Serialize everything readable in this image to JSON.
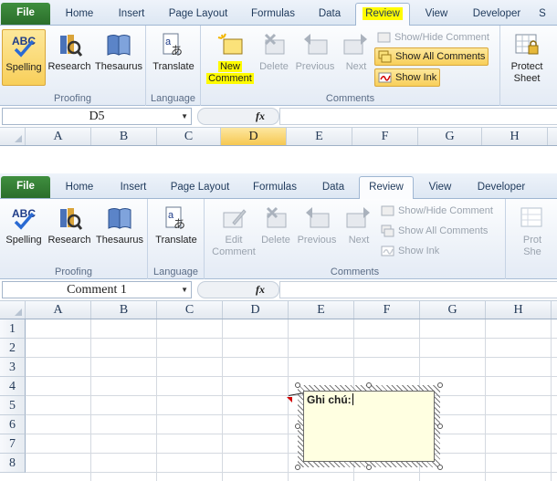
{
  "top": {
    "tabs": [
      "File",
      "Home",
      "Insert",
      "Page Layout",
      "Formulas",
      "Data",
      "Review",
      "View",
      "Developer",
      "S"
    ],
    "active_tab": "Review",
    "proofing": {
      "spelling": "Spelling",
      "research": "Research",
      "thesaurus": "Thesaurus",
      "label": "Proofing"
    },
    "language": {
      "translate": "Translate",
      "label": "Language"
    },
    "comments": {
      "new_comment_line1": "New",
      "new_comment_line2": "Comment",
      "delete": "Delete",
      "previous": "Previous",
      "next": "Next",
      "show_hide": "Show/Hide Comment",
      "show_all": "Show All Comments",
      "show_ink": "Show Ink",
      "label": "Comments"
    },
    "protect": {
      "line1": "Protect",
      "line2": "Sheet"
    },
    "name_box": "D5",
    "fx": "fx",
    "columns": [
      "A",
      "B",
      "C",
      "D",
      "E",
      "F",
      "G",
      "H"
    ],
    "selected_column": "D"
  },
  "bottom": {
    "tabs": [
      "File",
      "Home",
      "Insert",
      "Page Layout",
      "Formulas",
      "Data",
      "Review",
      "View",
      "Developer"
    ],
    "active_tab": "Review",
    "proofing": {
      "spelling": "Spelling",
      "research": "Research",
      "thesaurus": "Thesaurus",
      "label": "Proofing"
    },
    "language": {
      "translate": "Translate",
      "label": "Language"
    },
    "comments": {
      "edit_comment_line1": "Edit",
      "edit_comment_line2": "Comment",
      "delete": "Delete",
      "previous": "Previous",
      "next": "Next",
      "show_hide": "Show/Hide Comment",
      "show_all": "Show All Comments",
      "show_ink": "Show Ink",
      "label": "Comments"
    },
    "protect": {
      "line1": "Prot",
      "line2": "She"
    },
    "name_box": "Comment 1",
    "fx": "fx",
    "columns": [
      "A",
      "B",
      "C",
      "D",
      "E",
      "F",
      "G",
      "H"
    ],
    "rows": [
      "1",
      "2",
      "3",
      "4",
      "5",
      "6",
      "7",
      "8"
    ],
    "comment_text": "Ghi chú:"
  }
}
